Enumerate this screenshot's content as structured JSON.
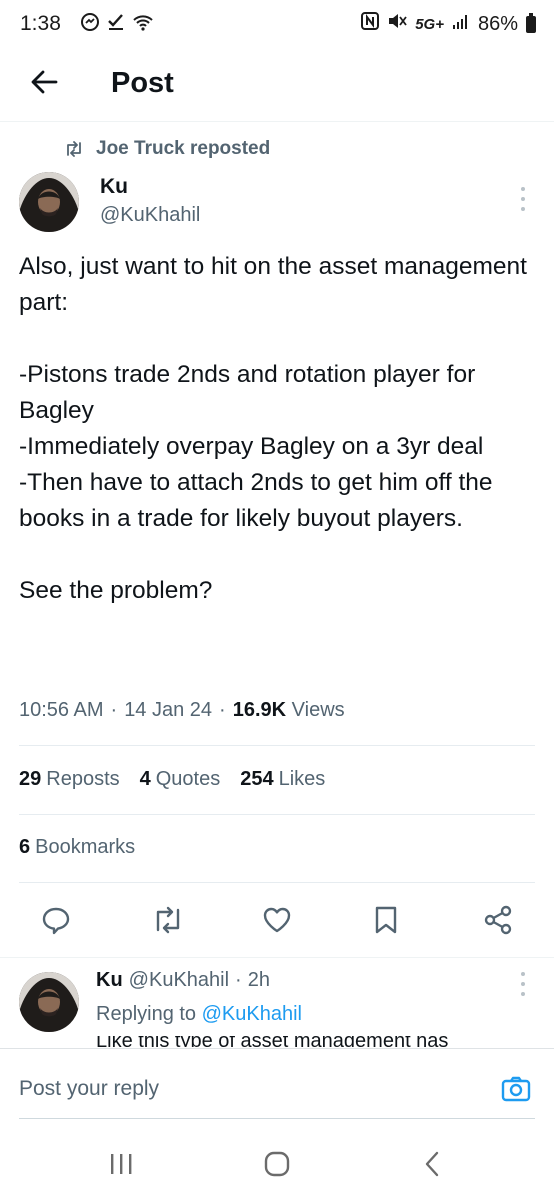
{
  "status_bar": {
    "time": "1:38",
    "network": "5G+",
    "battery": "86%",
    "left_icons": [
      "messenger-icon",
      "check-icon",
      "wifi-icon"
    ],
    "right_icons": [
      "nfc-icon",
      "mute-icon",
      "signal-icon",
      "battery-icon"
    ]
  },
  "header": {
    "title": "Post",
    "back_icon": "arrow-left-icon"
  },
  "repost": {
    "text": "Joe Truck reposted",
    "icon": "repost-icon"
  },
  "tweet": {
    "author_name": "Ku",
    "author_handle": "@KuKhahil",
    "text": "Also, just want to hit on the asset management part:\n\n-Pistons trade 2nds and rotation player for Bagley\n-Immediately overpay Bagley on a 3yr deal\n-Then have to attach 2nds to get him off the books in a trade for likely buyout players.\n\nSee the problem?",
    "time": "10:56 AM",
    "date": "14 Jan 24",
    "views_count": "16.9K",
    "views_label": "Views",
    "separator": "·"
  },
  "stats": {
    "reposts_count": "29",
    "reposts_label": "Reposts",
    "quotes_count": "4",
    "quotes_label": "Quotes",
    "likes_count": "254",
    "likes_label": "Likes",
    "bookmarks_count": "6",
    "bookmarks_label": "Bookmarks"
  },
  "actions": [
    "reply-icon",
    "repost-icon",
    "like-icon",
    "bookmark-icon",
    "share-icon"
  ],
  "reply": {
    "author_name": "Ku",
    "author_handle": "@KuKhahil",
    "time": "2h",
    "separator": "·",
    "replying_prefix": "Replying to",
    "replying_handle": "@KuKhahil",
    "snippet": "Like this type of asset management has"
  },
  "compose": {
    "placeholder": "Post your reply",
    "camera_icon": "camera-icon"
  },
  "nav": [
    "recents-icon",
    "home-icon",
    "back-icon"
  ],
  "colors": {
    "accent": "#1d9bf0",
    "text_primary": "#0f1419",
    "text_secondary": "#536471"
  }
}
